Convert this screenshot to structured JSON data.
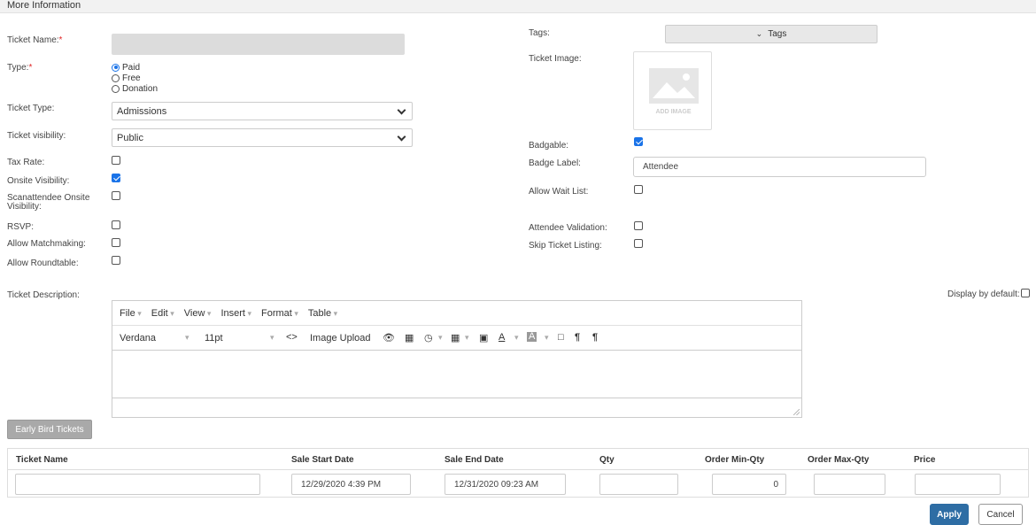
{
  "header": {
    "title": "More Information"
  },
  "form": {
    "ticket_name_label": "Ticket Name:",
    "required_mark": "*",
    "ticket_name_value": "",
    "type_label": "Type:",
    "type_options": [
      "Paid",
      "Free",
      "Donation"
    ],
    "type_selected": "Paid",
    "ticket_type_label": "Ticket Type:",
    "ticket_type_value": "Admissions",
    "ticket_visibility_label": "Ticket visibility:",
    "ticket_visibility_value": "Public",
    "tax_rate_label": "Tax Rate:",
    "tax_rate_checked": false,
    "onsite_visibility_label": "Onsite Visibility:",
    "onsite_visibility_checked": true,
    "scanattendee_label_1": "Scanattendee Onsite",
    "scanattendee_label_2": "Visibility:",
    "scanattendee_checked": false,
    "rsvp_label": "RSVP:",
    "rsvp_checked": false,
    "matchmaking_label": "Allow Matchmaking:",
    "matchmaking_checked": false,
    "roundtable_label": "Allow Roundtable:",
    "roundtable_checked": false,
    "tags_label": "Tags:",
    "tags_button": "Tags",
    "ticket_image_label": "Ticket Image:",
    "add_image_text": "ADD IMAGE",
    "badgable_label": "Badgable:",
    "badgable_checked": true,
    "badge_label_label": "Badge Label:",
    "badge_label_value": "Attendee",
    "wait_list_label": "Allow Wait List:",
    "wait_list_checked": false,
    "attendee_validation_label": "Attendee Validation:",
    "attendee_validation_checked": false,
    "skip_listing_label": "Skip Ticket Listing:",
    "skip_listing_checked": false,
    "description_label": "Ticket Description:",
    "display_default_label": "Display by default:",
    "display_default_checked": false
  },
  "editor": {
    "menus": [
      "File",
      "Edit",
      "View",
      "Insert",
      "Format",
      "Table"
    ],
    "font_family": "Verdana",
    "font_size": "11pt",
    "image_upload": "Image Upload"
  },
  "early_bird": {
    "button": "Early Bird Tickets",
    "columns": [
      "Ticket Name",
      "Sale Start Date",
      "Sale End Date",
      "Qty",
      "Order Min-Qty",
      "Order Max-Qty",
      "Price"
    ],
    "row": {
      "ticket_name": "",
      "sale_start": "12/29/2020 4:39 PM",
      "sale_end": "12/31/2020 09:23 AM",
      "qty": "",
      "min_qty": "0",
      "max_qty": "",
      "price": ""
    }
  },
  "actions": {
    "apply": "Apply",
    "cancel": "Cancel"
  },
  "colors": {
    "accent": "#1a73e8",
    "apply": "#2e6da4",
    "required": "#e02424"
  }
}
